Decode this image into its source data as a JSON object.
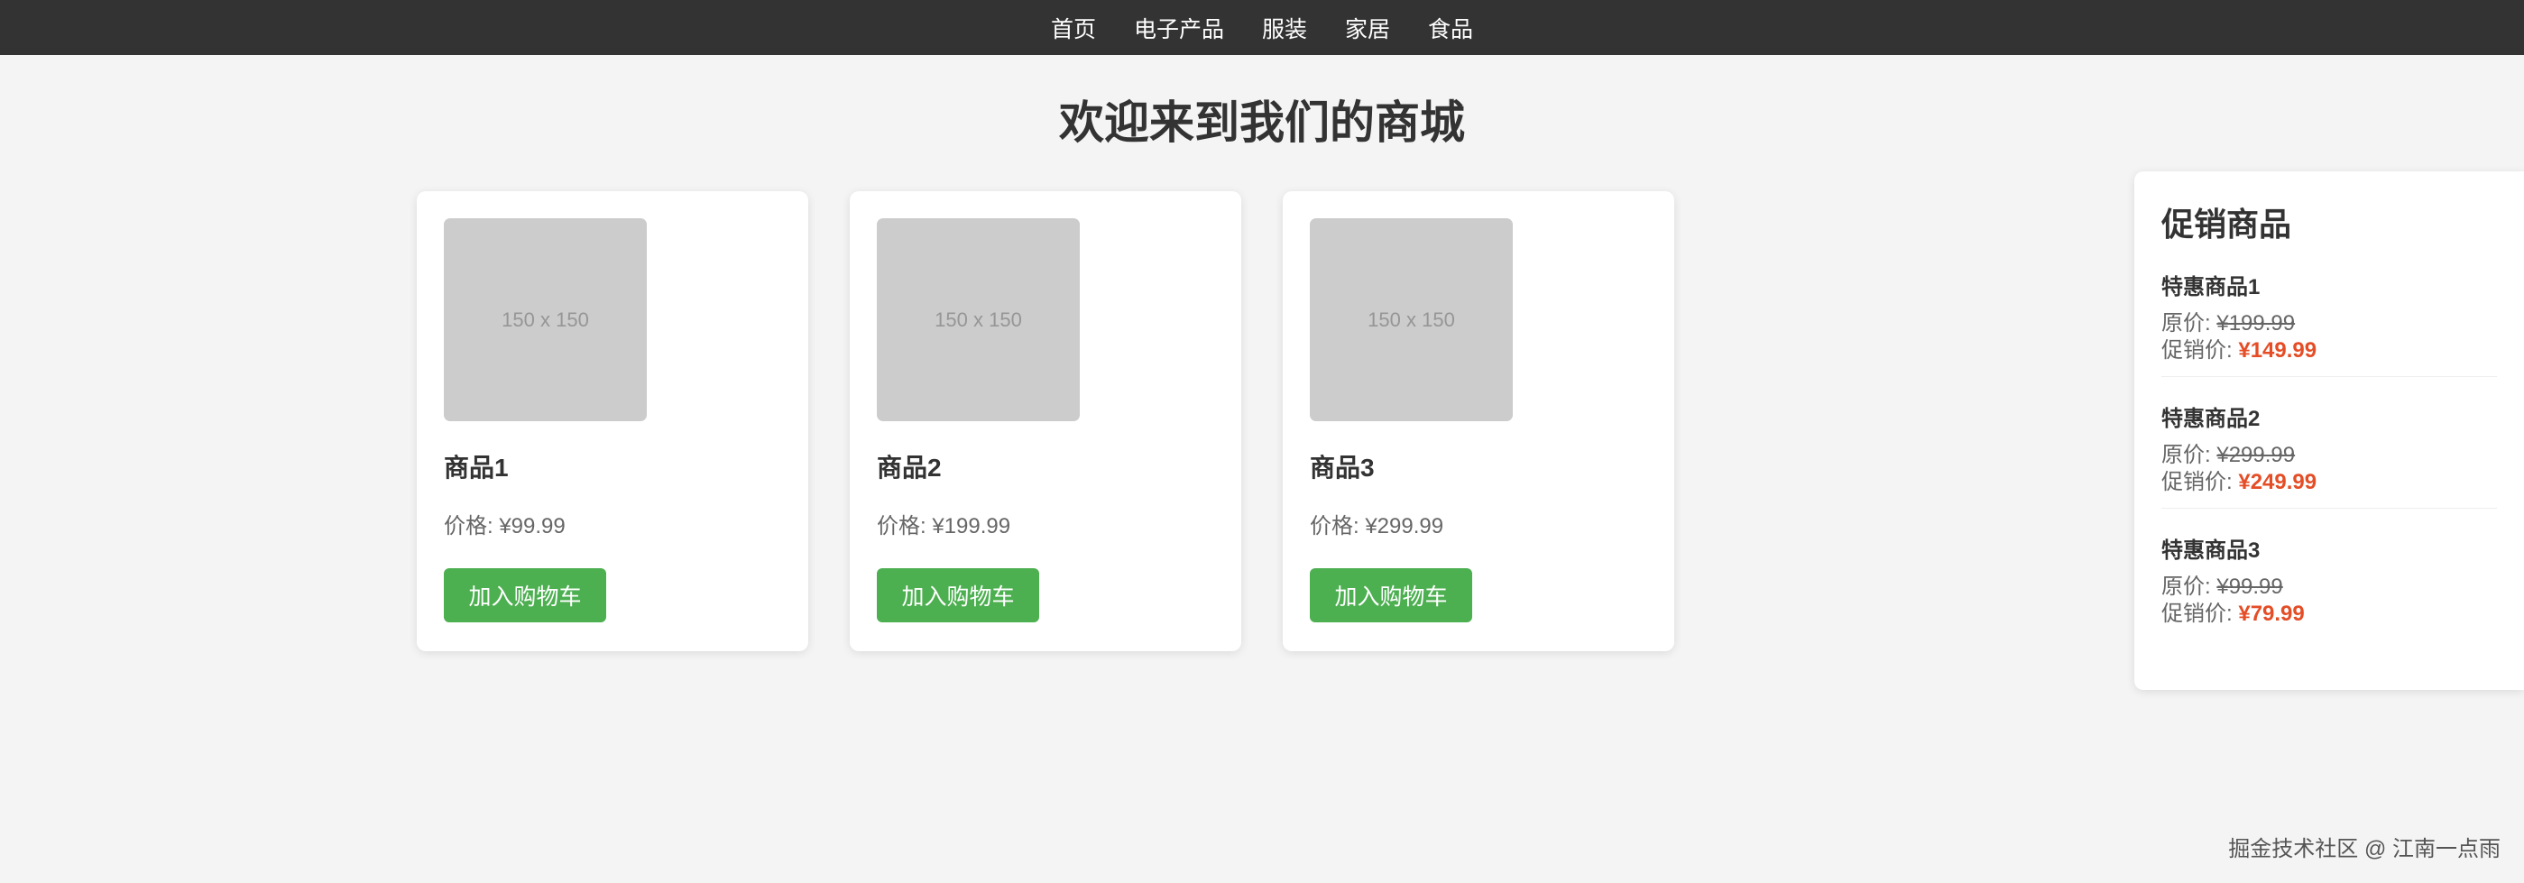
{
  "nav": {
    "items": [
      "首页",
      "电子产品",
      "服装",
      "家居",
      "食品"
    ]
  },
  "page_title": "欢迎来到我们的商城",
  "products": [
    {
      "image_text": "150 x 150",
      "name": "商品1",
      "price": "价格: ¥99.99",
      "button": "加入购物车"
    },
    {
      "image_text": "150 x 150",
      "name": "商品2",
      "price": "价格: ¥199.99",
      "button": "加入购物车"
    },
    {
      "image_text": "150 x 150",
      "name": "商品3",
      "price": "价格: ¥299.99",
      "button": "加入购物车"
    }
  ],
  "promotions": {
    "title": "促销商品",
    "items": [
      {
        "name": "特惠商品1",
        "orig_label": "原价: ",
        "orig_value": "¥199.99",
        "sale_label": "促销价: ",
        "sale_value": "¥149.99"
      },
      {
        "name": "特惠商品2",
        "orig_label": "原价: ",
        "orig_value": "¥299.99",
        "sale_label": "促销价: ",
        "sale_value": "¥249.99"
      },
      {
        "name": "特惠商品3",
        "orig_label": "原价: ",
        "orig_value": "¥99.99",
        "sale_label": "促销价: ",
        "sale_value": "¥79.99"
      }
    ]
  },
  "watermark": "掘金技术社区 @ 江南一点雨",
  "colors": {
    "nav_bg": "#333333",
    "page_bg": "#f4f4f4",
    "button_bg": "#4caf50",
    "sale_price": "#e44d26",
    "image_placeholder": "#cccccc"
  }
}
